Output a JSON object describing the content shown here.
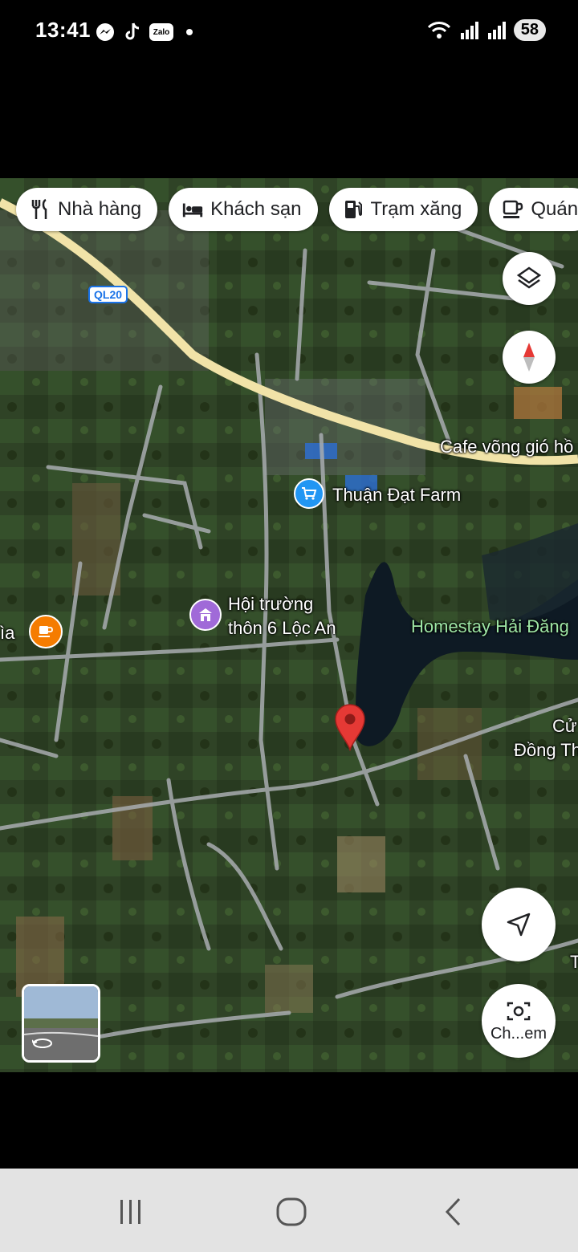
{
  "status": {
    "time": "13:41",
    "battery": "58",
    "zalo_label": "Zalo"
  },
  "chips": [
    {
      "label": "Nhà hàng",
      "icon": "restaurant-icon"
    },
    {
      "label": "Khách sạn",
      "icon": "hotel-icon"
    },
    {
      "label": "Trạm xăng",
      "icon": "gas-station-icon"
    },
    {
      "label": "Quán",
      "icon": "cafe-icon"
    }
  ],
  "map": {
    "road_shield": "QL20",
    "places": {
      "cafe_vong": "Cafe võng gió hồ",
      "thuan_dat": "Thuận Đạt Farm",
      "hoi_truong_1": "Hội trường",
      "hoi_truong_2": "thôn 6 Lộc An",
      "homestay": "Homestay Hải Đăng",
      "cafe_left": "ìa",
      "cua_1": "Cử",
      "cua_2": "Đồng Th",
      "edge_t": "T"
    },
    "chip_lens_label": "Ch...em"
  },
  "colors": {
    "pin": "#e53935",
    "shop_poi": "#2196f3",
    "hall_poi": "#a06ad8",
    "cafe_poi": "#f57c00",
    "highway": "#f1e3a8"
  }
}
